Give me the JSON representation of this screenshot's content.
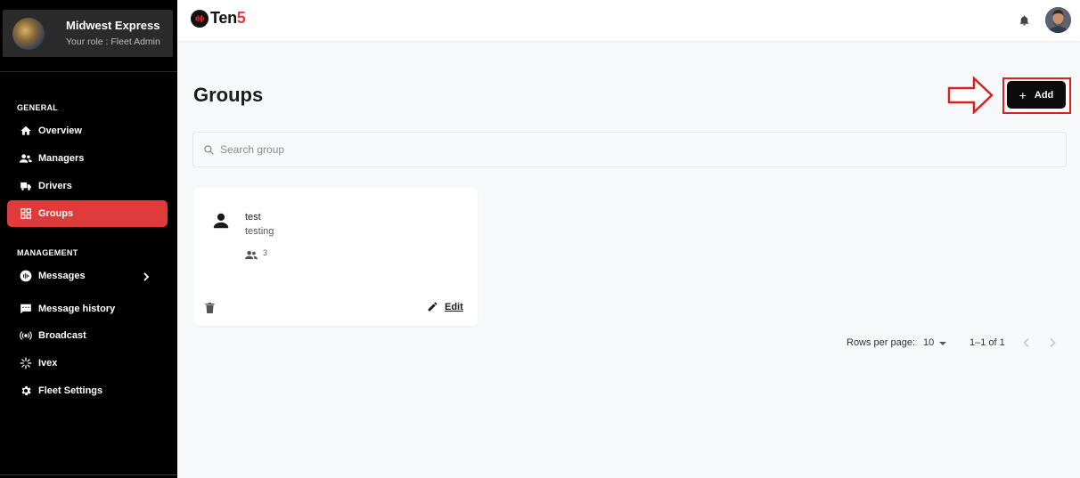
{
  "sidebar": {
    "org": {
      "name": "Midwest Express",
      "role": "Your role : Fleet Admin"
    },
    "sections": [
      {
        "label": "GENERAL"
      },
      {
        "label": "MANAGEMENT"
      }
    ],
    "items": [
      {
        "label": "Overview",
        "icon": "home-icon"
      },
      {
        "label": "Managers",
        "icon": "managers-icon"
      },
      {
        "label": "Drivers",
        "icon": "truck-icon"
      },
      {
        "label": "Groups",
        "icon": "grid-icon",
        "active": true
      },
      {
        "label": "Messages",
        "icon": "messages-icon"
      },
      {
        "label": "Message history",
        "icon": "chat-icon"
      },
      {
        "label": "Broadcast",
        "icon": "broadcast-icon"
      },
      {
        "label": "Ivex",
        "icon": "loader-icon"
      },
      {
        "label": "Fleet Settings",
        "icon": "gear-icon"
      }
    ],
    "active_color": "#e03b3b"
  },
  "header": {
    "logo": {
      "part1": "Ten",
      "part2": "5"
    }
  },
  "main": {
    "title": "Groups",
    "add_label": "Add",
    "add_plus": "+",
    "search": {
      "placeholder": "Search group",
      "value": ""
    },
    "groups": [
      {
        "name": "test",
        "description": "testing",
        "member_count": "3",
        "edit_label": "Edit"
      }
    ],
    "pagination": {
      "rows_per_page_label": "Rows per page:",
      "rows_per_page": "10",
      "range": "1–1 of 1"
    }
  },
  "annotation_color": "#d92020"
}
